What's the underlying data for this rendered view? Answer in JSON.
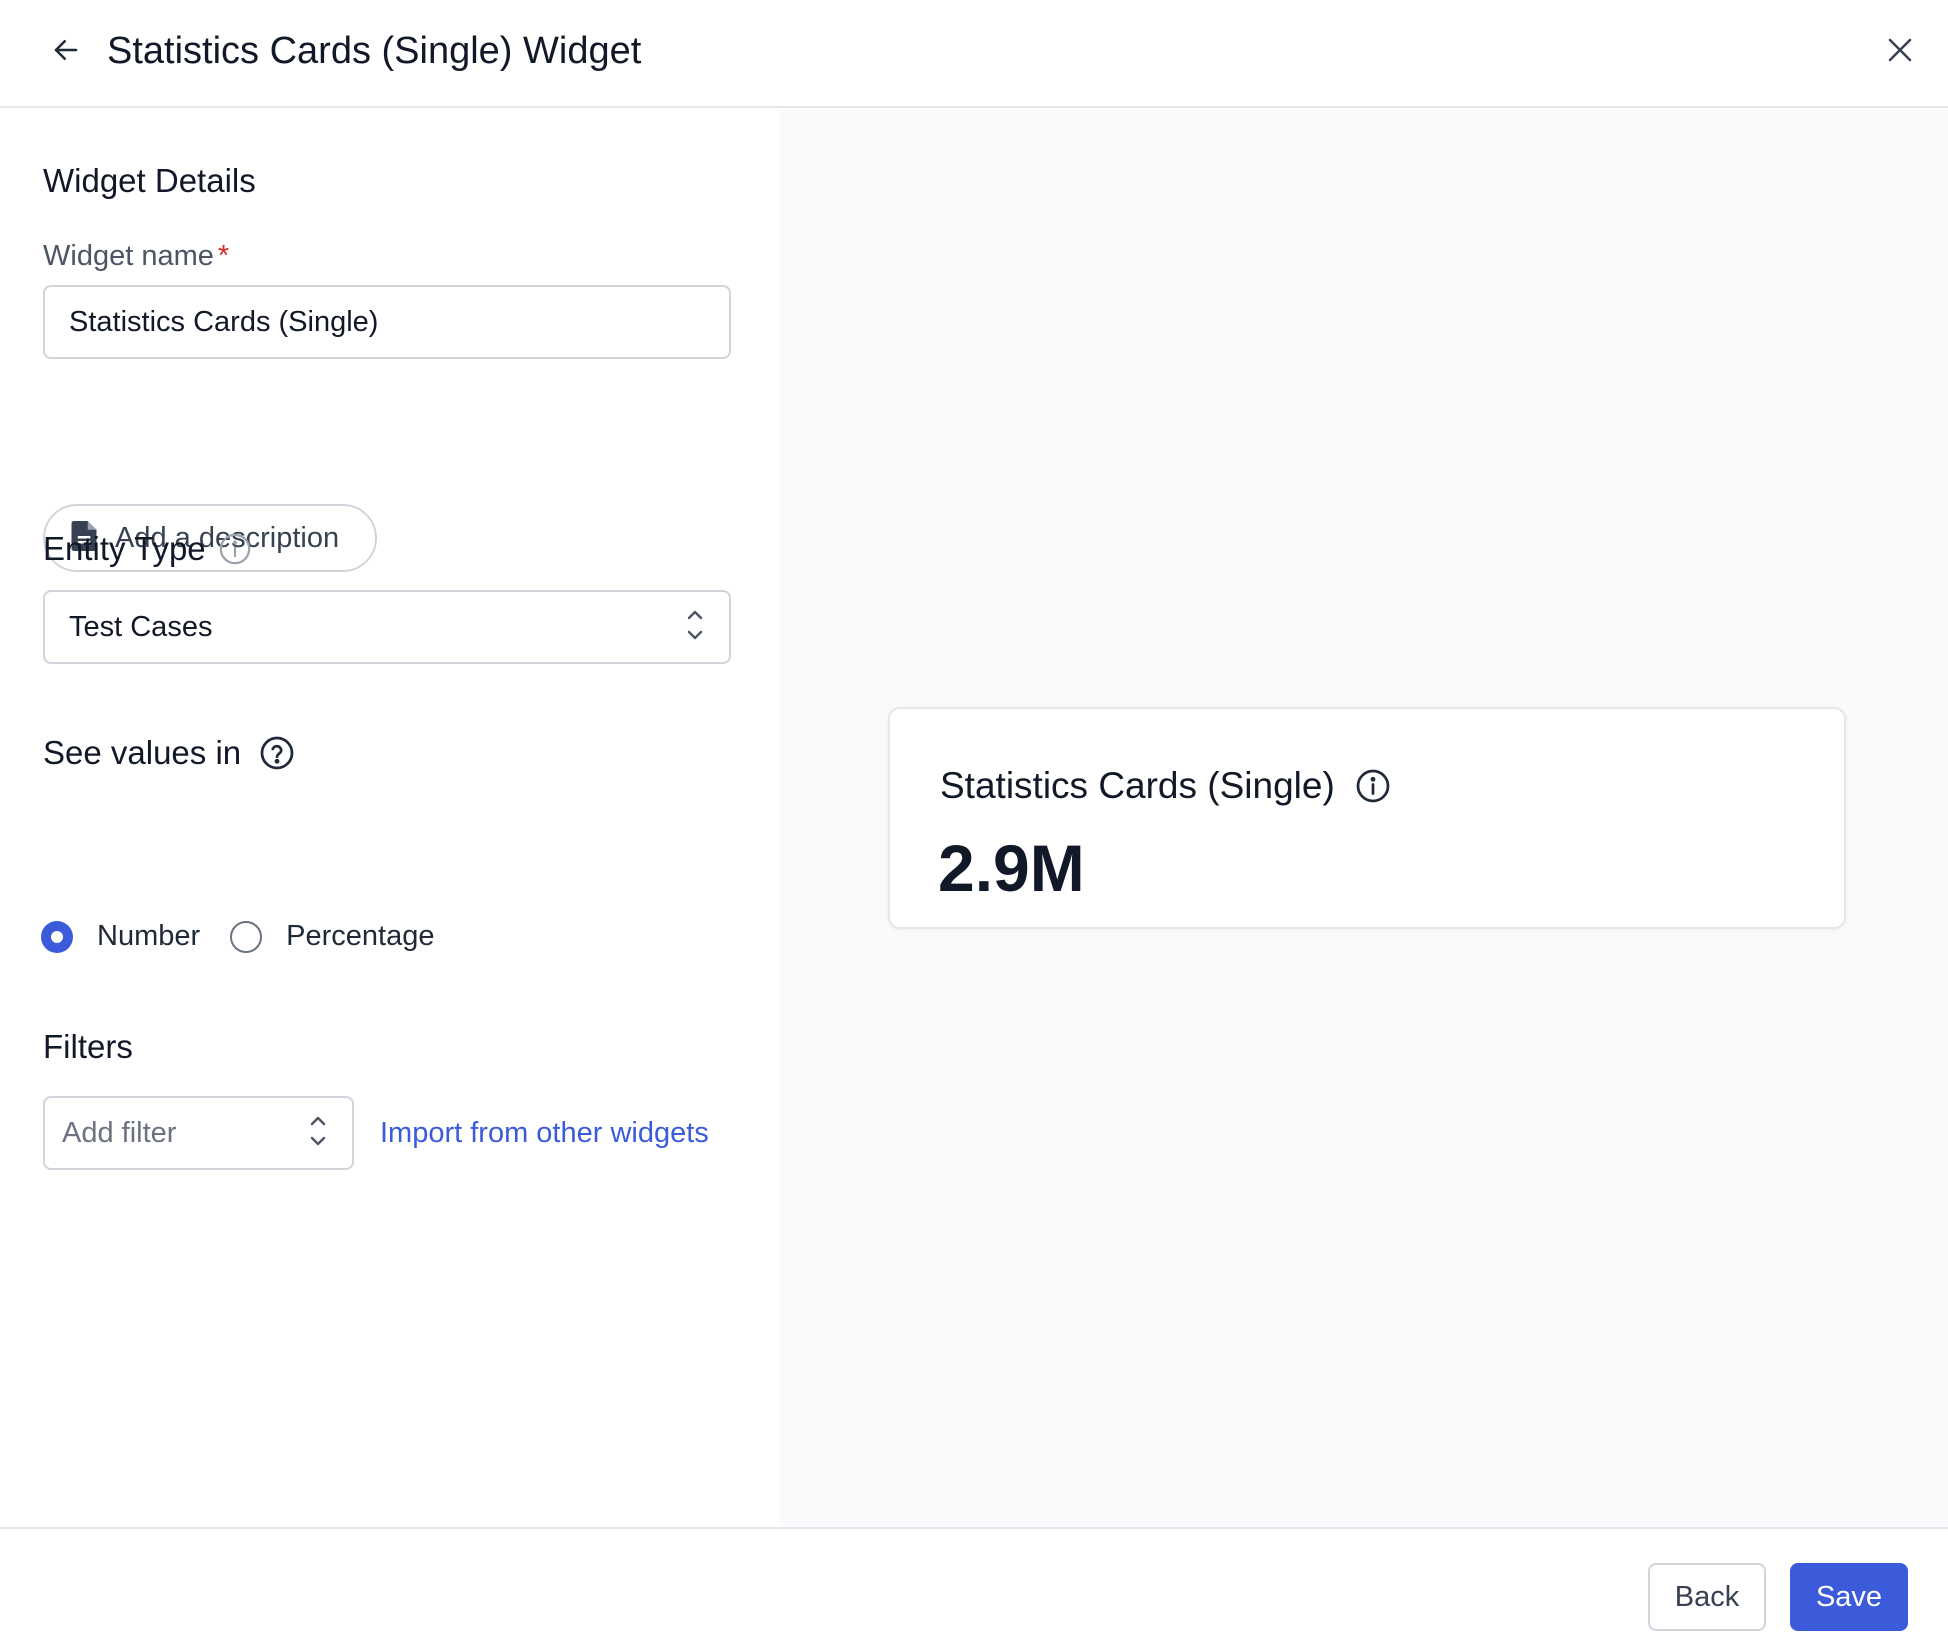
{
  "header": {
    "title": "Statistics Cards (Single) Widget",
    "back_icon": "arrow-left-icon",
    "close_icon": "close-icon"
  },
  "form": {
    "section_title": "Widget Details",
    "widget_name_label": "Widget name",
    "required_marker": "*",
    "widget_name_value": "Statistics Cards (Single)",
    "add_description_label": "Add a description",
    "entity_type_label": "Entity Type",
    "entity_type_value": "Test Cases",
    "see_values_label": "See values in",
    "value_options": [
      {
        "label": "Number",
        "selected": true
      },
      {
        "label": "Percentage",
        "selected": false
      }
    ],
    "filters_label": "Filters",
    "add_filter_placeholder": "Add filter",
    "import_link": "Import from other widgets"
  },
  "preview": {
    "card_title": "Statistics Cards (Single)",
    "card_value": "2.9M"
  },
  "footer": {
    "back_label": "Back",
    "save_label": "Save"
  },
  "colors": {
    "accent": "#3b5bdb",
    "required": "#dc2626",
    "preview_bg": "#f9fafb",
    "border": "#d1d5db"
  }
}
